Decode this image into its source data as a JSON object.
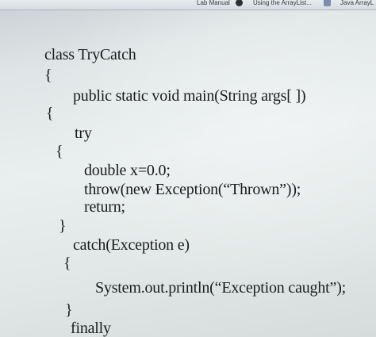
{
  "bookmarks": {
    "items": [
      {
        "label": "Lab Manual",
        "icon": "none"
      },
      {
        "label": "Using the ArrayList...",
        "icon": "globe-icon"
      },
      {
        "label": "Java ArrayL",
        "icon": "java-icon"
      }
    ]
  },
  "code": {
    "lines": [
      "class TryCatch",
      "{",
      "public static void main(String args[ ])",
      "{",
      "try",
      "{",
      "double x=0.0;",
      "throw(new Exception(“Thrown”));",
      "return;",
      "}",
      "catch(Exception e)",
      "{",
      "System.out.println(“Exception caught”);",
      "}",
      "finally"
    ]
  }
}
